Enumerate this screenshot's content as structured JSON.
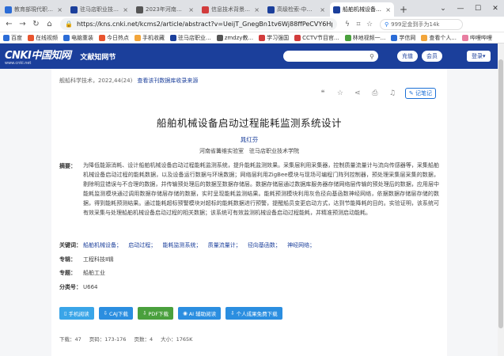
{
  "tabs": [
    {
      "title": "教育部現代职业...",
      "color": "#2b6cd6",
      "active": false
    },
    {
      "title": "驻马店职业技术学",
      "color": "#1b3f9b",
      "active": false
    },
    {
      "title": "2023年河南省驰...",
      "color": "#555555",
      "active": false
    },
    {
      "title": "信息技术背景下职",
      "color": "#d23c3c",
      "active": false
    },
    {
      "title": "高级检索-中国知网",
      "color": "#1b3f9b",
      "active": false
    },
    {
      "title": "船舶机械设备启动",
      "color": "#1b3f9b",
      "active": true
    }
  ],
  "address": {
    "url": "https://kns.cnki.net/kcms2/article/abstract?v=UeijT_GnegBn1tv6Wj88ffPeCVY6HpLypEP4j",
    "search_text": "999足金到手为14k"
  },
  "bookmarks": [
    {
      "label": "百度",
      "color": "#2b6cd6"
    },
    {
      "label": "在线视频",
      "color": "#e8542e"
    },
    {
      "label": "电脑重装",
      "color": "#2b6cd6"
    },
    {
      "label": "今日热点",
      "color": "#e8542e"
    },
    {
      "label": "手机收藏",
      "color": "#f2a53b"
    },
    {
      "label": "驻马店职业...",
      "color": "#1b3f9b"
    },
    {
      "label": "zmdzy教...",
      "color": "#555555"
    },
    {
      "label": "学习强国",
      "color": "#d23c3c"
    },
    {
      "label": "CCTV节目官...",
      "color": "#d23c3c"
    },
    {
      "label": "林地视频一...",
      "color": "#4aa03d"
    },
    {
      "label": "学信网",
      "color": "#2b6cd6"
    },
    {
      "label": "查看个人...",
      "color": "#f2a53b"
    },
    {
      "label": "哔哩哔哩",
      "color": "#e87ea1"
    }
  ],
  "header": {
    "logo_main": "CNKI中国知网",
    "logo_sub": "www.cnki.net",
    "sitename": "文献知网节",
    "recharge": "充值",
    "member": "会员",
    "login": "登录"
  },
  "paper": {
    "source_journal": "舰船科学技术",
    "source_issue": "2022,44(24)",
    "source_link": "查看该刊数据库收录来源",
    "note_btn": "记笔记",
    "title": "船舶机械设备启动过程能耗监测系统设计",
    "author": "晁红芬",
    "affiliation": "河南省篝维实验室　驻马店职业技术学院",
    "abstract_label": "摘要：",
    "abstract": "为降低能源消耗、设计船舶机械设备启动过程能耗监测系统，提升能耗监测效果。采集层利用采集器，控制质量流量计与流向传感器等，采集船舶机械设备启动过程的能耗数据，以及设备运行数据与环境数据；网络层利用ZigBee模块与现场可编程门阵列控制器，预处理采集层采集的数据，剔除明显错误与不合理的数据，并传输预处理后的数据至数据存储层。数据存储层通过数据库服务器存储网络层传输的预处理后的数据，应用层中能耗监测模块通过调用数据存储层存储的数据，实时呈现能耗监测结果。能耗预测模块利用灰色径向基函数神经网络，依据数据存储层存储的数据，得到能耗预测结果。通过能耗超标预警模块对超标的能耗数据进行预警，提醒船员变更启动方式，达到节能降耗的目的。实验证明，该系统可有效采集与处理船舶机械设备启动过程的相关数据；该系统可有效监测机械设备启动过程能耗，并精准预测启动能耗。",
    "keywords_label": "关键词：",
    "keywords": [
      "船舶机械设备；",
      "启动过程；",
      "能耗监测系统；",
      "质量流量计；",
      "径向基函数；",
      "神经网络；"
    ],
    "special_label": "专辑：",
    "special": "工程科技Ⅱ辑",
    "topic_label": "专题：",
    "topic": "船舶工业",
    "class_label": "分类号：",
    "class": "U664",
    "buttons": {
      "read": "手机阅读",
      "caj": "CAJ下载",
      "pdf": "PDF下载",
      "ai": "AI 辅助阅读",
      "personal": "个人成果免费下载"
    },
    "stats": {
      "downloads": "下载：47",
      "pages_range": "页码：173-176",
      "pages": "页数：4",
      "size": "大小：1765K"
    }
  }
}
